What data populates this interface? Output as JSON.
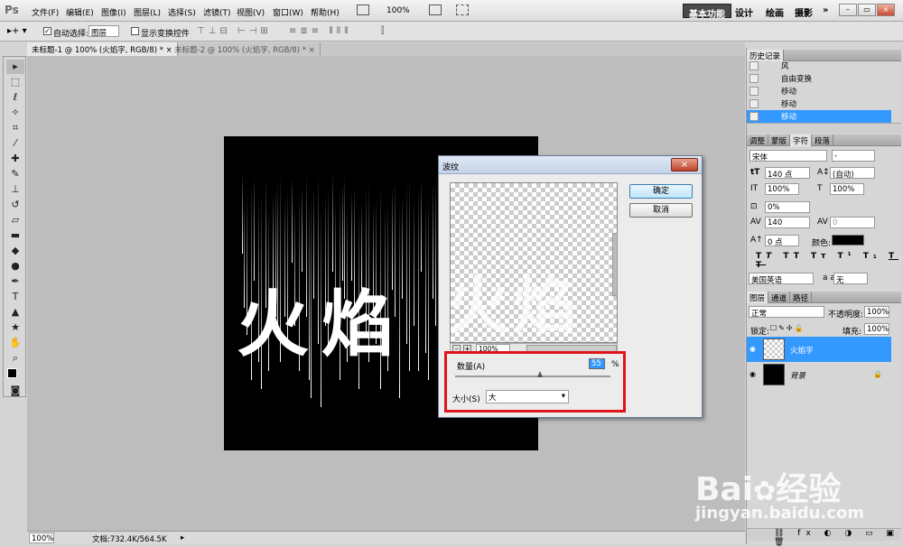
{
  "app": {
    "logo": "Ps"
  },
  "menu": [
    "文件(F)",
    "编辑(E)",
    "图像(I)",
    "图层(L)",
    "选择(S)",
    "滤镜(T)",
    "视图(V)",
    "窗口(W)",
    "帮助(H)"
  ],
  "menubar_zoom": "100%",
  "workspaces": [
    "基本功能",
    "设计",
    "绘画",
    "摄影",
    "»"
  ],
  "options_bar": {
    "auto_select_label": "自动选择:",
    "auto_select_value": "图层",
    "show_transform_label": "显示变换控件"
  },
  "doc_tabs": [
    {
      "label": "未标题-1 @ 100% (火焰字, RGB/8) *",
      "close": "×"
    },
    {
      "label": "未标题-2 @ 100% (火焰字, RGB/8) *",
      "close": "×"
    }
  ],
  "canvas_text": "火焰",
  "dialog": {
    "title": "波纹",
    "close": "×",
    "ok": "确定",
    "cancel": "取消",
    "preview_text": "火焰",
    "zoom": "100%",
    "amount_label": "数量(A)",
    "amount_value": "55",
    "amount_unit": "%",
    "size_label": "大小(S)",
    "size_value": "大"
  },
  "history": {
    "title": "历史记录",
    "items": [
      "风",
      "自由变换",
      "移动",
      "移动",
      "移动"
    ]
  },
  "char_panel": {
    "tabs": [
      "调整",
      "蒙版",
      "字符",
      "段落"
    ],
    "font": "宋体",
    "font_style": "-",
    "size": "140 点",
    "leading": "(自动)",
    "vscale": "100%",
    "hscale": "100%",
    "baseline_shift": "0%",
    "tracking": "140",
    "kerning": "0",
    "baseline": "0 点",
    "color_label": "颜色:",
    "language": "美国英语",
    "aa_label": "a a",
    "aa_value": "无",
    "styles": [
      "T",
      "T",
      "TT",
      "Tт",
      "T¹",
      "T₁",
      "T",
      "T"
    ]
  },
  "layers": {
    "tabs": [
      "图层",
      "通道",
      "路径"
    ],
    "blend": "正常",
    "opacity_label": "不透明度:",
    "opacity": "100%",
    "lock_label": "锁定:",
    "fill_label": "填充:",
    "fill": "100%",
    "items": [
      {
        "name": "火焰字",
        "selected": true
      },
      {
        "name": "背景",
        "selected": false
      }
    ]
  },
  "status": {
    "zoom": "100%",
    "doc": "文档:732.4K/564.5K"
  },
  "watermark": {
    "brand": "Bai",
    "brand2": "经验",
    "url": "jingyan.baidu.com"
  }
}
